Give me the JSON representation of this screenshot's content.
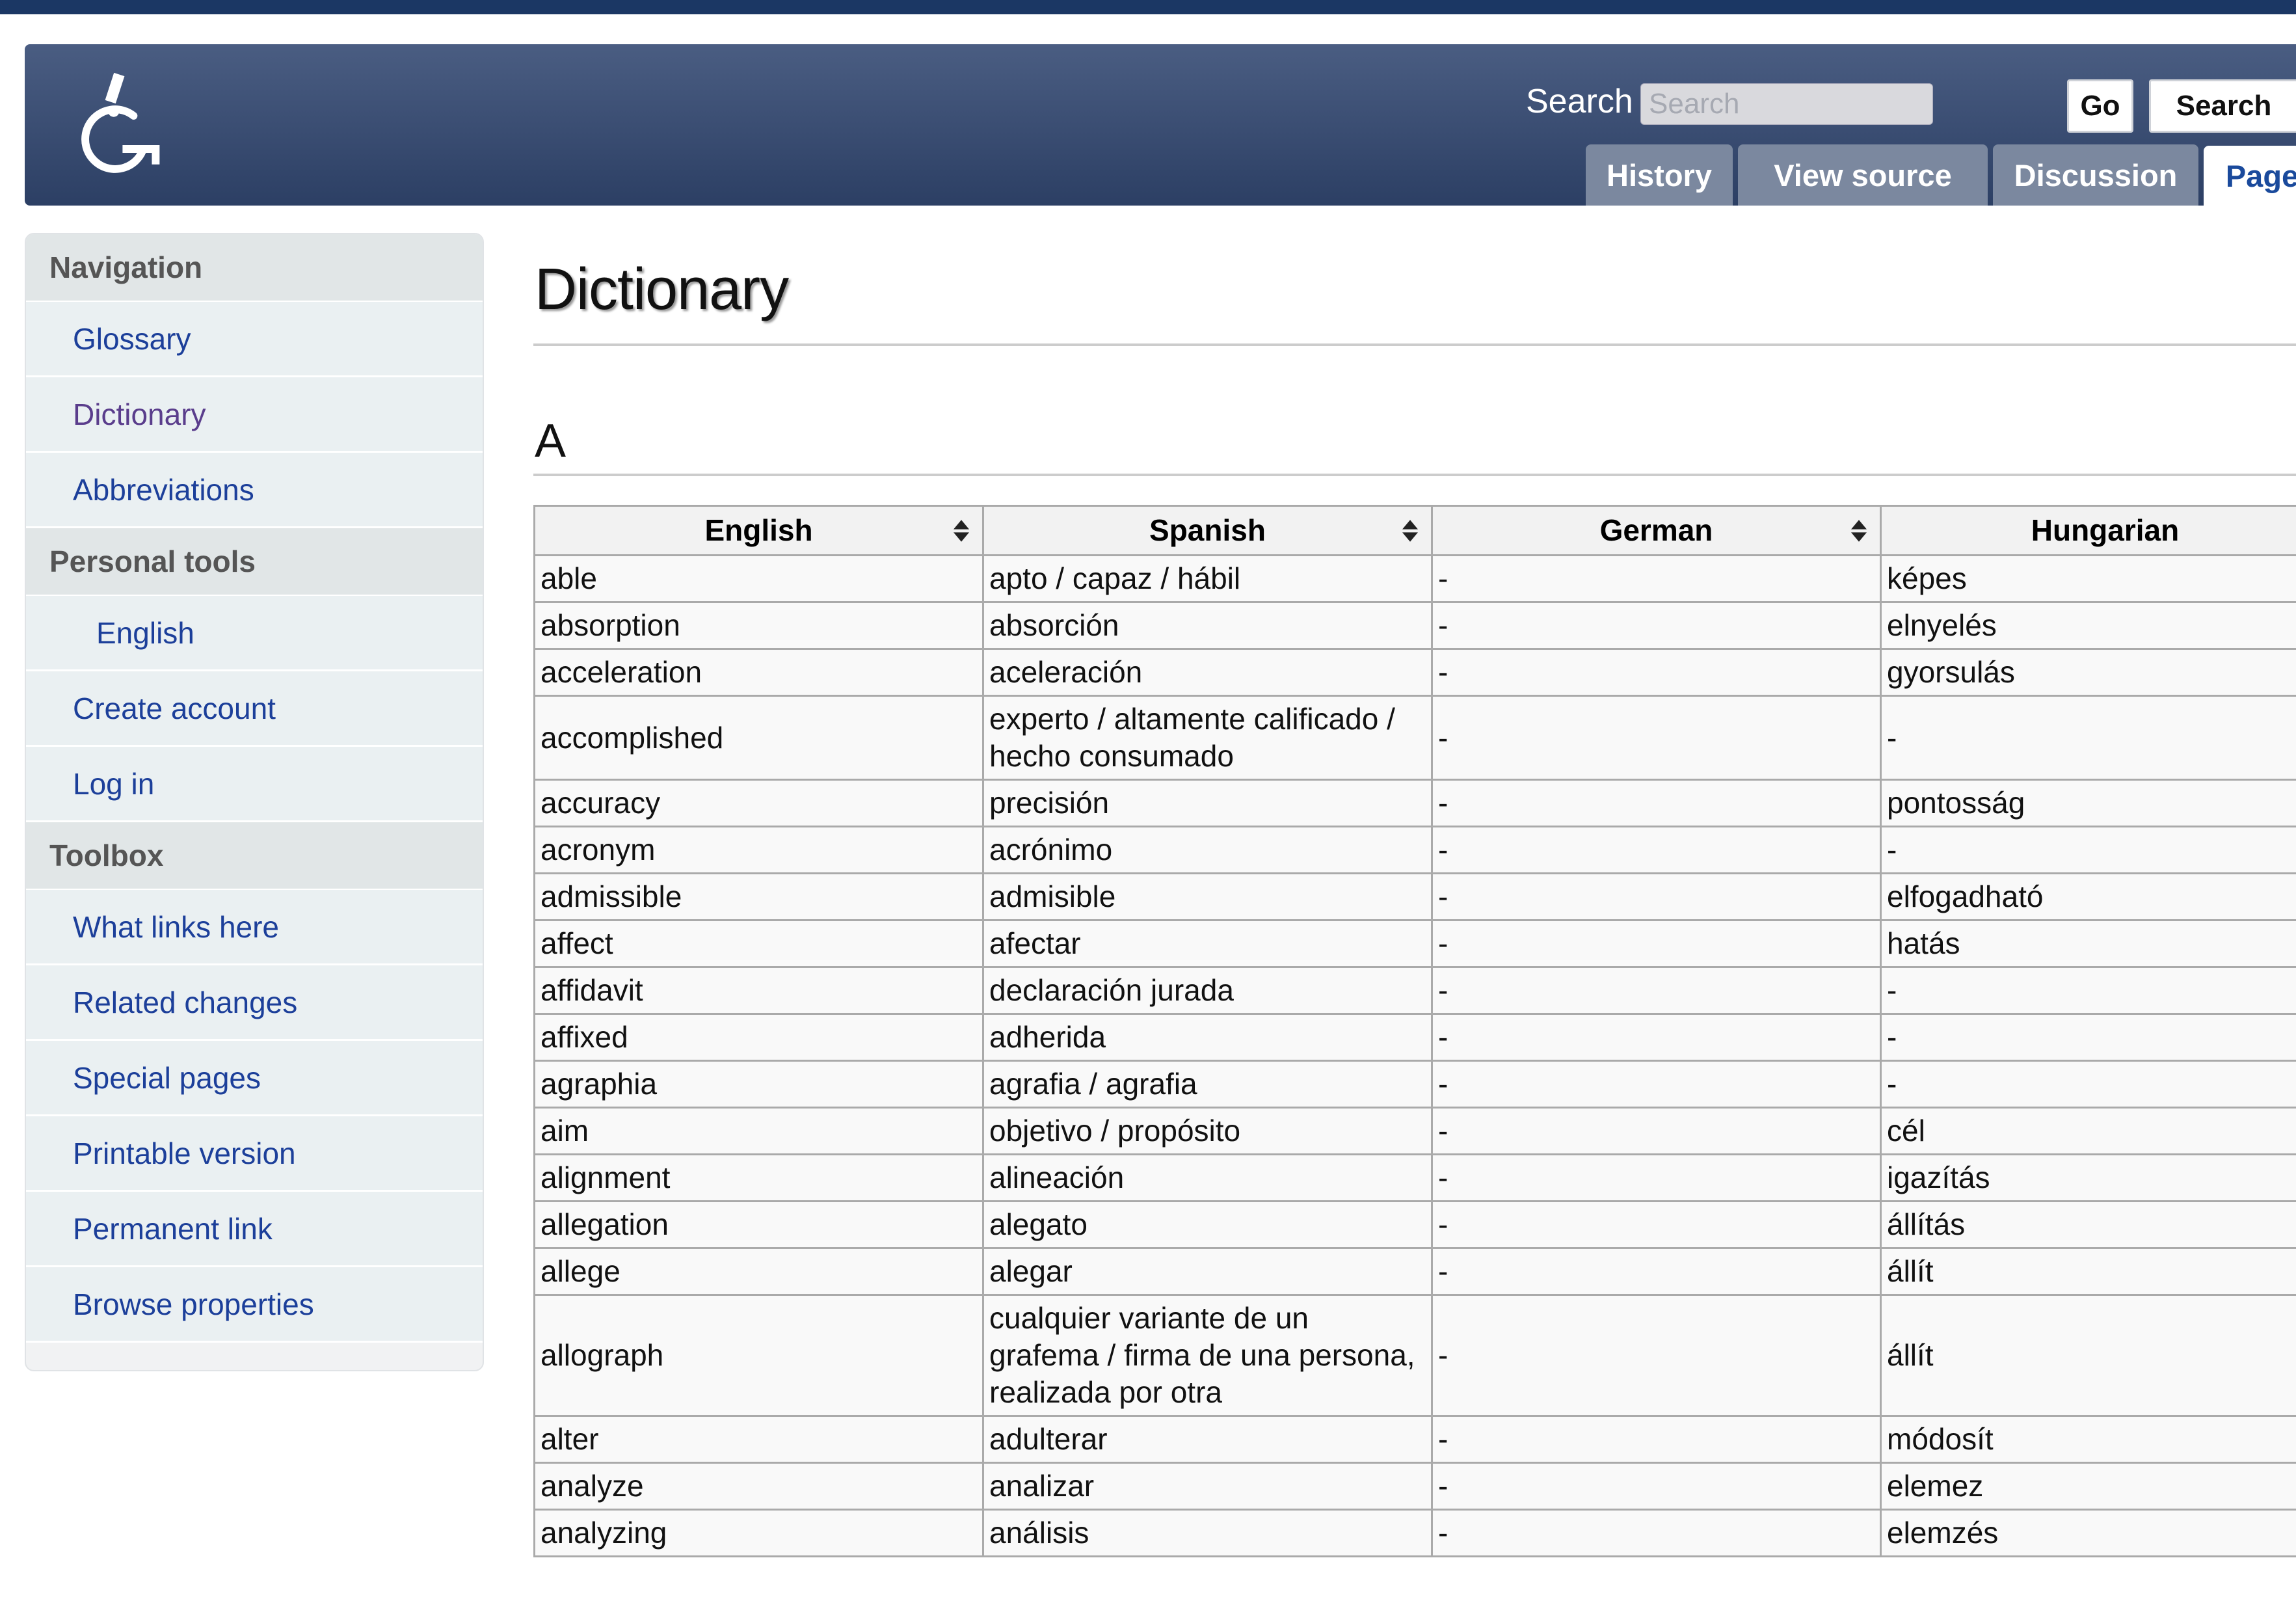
{
  "header": {
    "search_label": "Search",
    "search_placeholder": "Search",
    "go_label": "Go",
    "search_button_label": "Search",
    "tabs": [
      {
        "label": "History"
      },
      {
        "label": "View source"
      },
      {
        "label": "Discussion"
      },
      {
        "label": "Page",
        "active": true
      }
    ],
    "logo_icon": "microscope-g-logo",
    "colors": {
      "header_top": "#4a5d82",
      "header_bottom": "#2c3f64",
      "link": "#1c3f9a",
      "visited_link": "#5a3d8c"
    }
  },
  "sidebar": {
    "navigation": {
      "title": "Navigation",
      "items": [
        {
          "label": "Glossary"
        },
        {
          "label": "Dictionary"
        },
        {
          "label": "Abbreviations"
        }
      ]
    },
    "personal_tools": {
      "title": "Personal tools",
      "items": [
        {
          "label": "English"
        },
        {
          "label": "Create account"
        },
        {
          "label": "Log in"
        }
      ]
    },
    "toolbox": {
      "title": "Toolbox",
      "items": [
        {
          "label": "What links here"
        },
        {
          "label": "Related changes"
        },
        {
          "label": "Special pages"
        },
        {
          "label": "Printable version"
        },
        {
          "label": "Permanent link"
        },
        {
          "label": "Browse properties"
        }
      ]
    }
  },
  "main": {
    "title": "Dictionary",
    "section_heading": "A",
    "table": {
      "columns": [
        "English",
        "Spanish",
        "German",
        "Hungarian"
      ],
      "rows": [
        [
          "able",
          "apto / capaz / hábil",
          "-",
          "képes"
        ],
        [
          "absorption",
          "absorción",
          "-",
          "elnyelés"
        ],
        [
          "acceleration",
          "aceleración",
          "-",
          "gyorsulás"
        ],
        [
          "accomplished",
          "experto / altamente calificado / hecho consumado",
          "-",
          "-"
        ],
        [
          "accuracy",
          "precisión",
          "-",
          "pontosság"
        ],
        [
          "acronym",
          "acrónimo",
          "-",
          "-"
        ],
        [
          "admissible",
          "admisible",
          "-",
          "elfogadható"
        ],
        [
          "affect",
          "afectar",
          "-",
          "hatás"
        ],
        [
          "affidavit",
          "declaración jurada",
          "-",
          "-"
        ],
        [
          "affixed",
          "adherida",
          "-",
          "-"
        ],
        [
          "agraphia",
          "agrafia / agrafia",
          "-",
          "-"
        ],
        [
          "aim",
          "objetivo / propósito",
          "-",
          "cél"
        ],
        [
          "alignment",
          "alineación",
          "-",
          "igazítás"
        ],
        [
          "allegation",
          "alegato",
          "-",
          "állítás"
        ],
        [
          "allege",
          "alegar",
          "-",
          "állít"
        ],
        [
          "allograph",
          "cualquier variante de un grafema / firma de una persona, realizada por otra",
          "-",
          "állít"
        ],
        [
          "alter",
          "adulterar",
          "-",
          "módosít"
        ],
        [
          "analyze",
          "analizar",
          "-",
          "elemez"
        ],
        [
          "analyzing",
          "análisis",
          "-",
          "elemzés"
        ]
      ]
    }
  }
}
